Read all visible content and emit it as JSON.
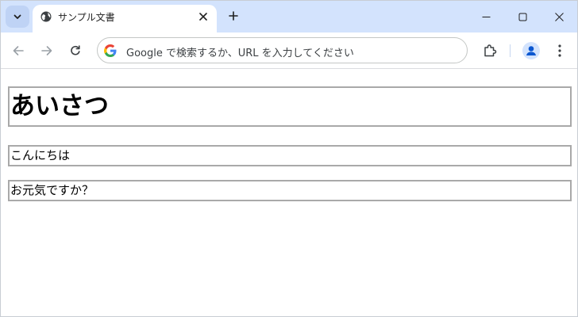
{
  "tab": {
    "title": "サンプル文書"
  },
  "omnibox": {
    "text": "Google で検索するか、URL を入力してください"
  },
  "page": {
    "heading": "あいさつ",
    "paragraphs": [
      "こんにちは",
      "お元気ですか？"
    ]
  },
  "icons": {
    "tab_search": "chevron-down-icon",
    "favicon": "globe-icon",
    "tab_close": "close-icon",
    "new_tab": "plus-icon",
    "minimize": "minimize-icon",
    "maximize": "maximize-icon",
    "close": "close-icon",
    "back": "arrow-left-icon",
    "forward": "arrow-right-icon",
    "reload": "reload-icon",
    "google": "google-g-icon",
    "extensions": "puzzle-icon",
    "profile": "profile-icon",
    "menu": "kebab-menu-icon"
  },
  "colors": {
    "tabstrip": "#d3e3fd",
    "profile_accent": "#0b57d0",
    "border": "#a9a9a9"
  }
}
